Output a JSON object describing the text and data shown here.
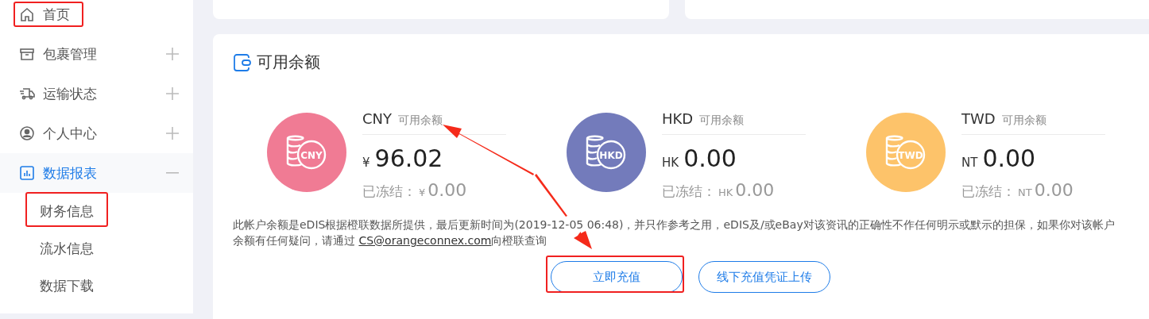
{
  "sidebar": {
    "items": [
      {
        "label": "首页",
        "kind": "link",
        "expanded": false
      },
      {
        "label": "包裹管理",
        "kind": "group",
        "expanded": false
      },
      {
        "label": "运输状态",
        "kind": "group",
        "expanded": false
      },
      {
        "label": "个人中心",
        "kind": "group",
        "expanded": false
      },
      {
        "label": "数据报表",
        "kind": "group",
        "expanded": true,
        "children": [
          {
            "label": "财务信息"
          },
          {
            "label": "流水信息"
          },
          {
            "label": "数据下载"
          }
        ]
      }
    ]
  },
  "balance_card": {
    "title": "可用余额",
    "balances": [
      {
        "currency": "CNY",
        "label": "可用余额",
        "color": "#f07b94",
        "icon_label": "CNY",
        "symbol": "¥",
        "amount": "96.02",
        "frozen_label": "已冻结：",
        "frozen_symbol": "¥",
        "frozen_amount": "0.00"
      },
      {
        "currency": "HKD",
        "label": "可用余额",
        "color": "#737bbb",
        "icon_label": "HKD",
        "symbol": "HK",
        "amount": "0.00",
        "frozen_label": "已冻结：",
        "frozen_symbol": "HK",
        "frozen_amount": "0.00"
      },
      {
        "currency": "TWD",
        "label": "可用余额",
        "color": "#fdc36a",
        "icon_label": "TWD",
        "symbol": "NT",
        "amount": "0.00",
        "frozen_label": "已冻结：",
        "frozen_symbol": "NT",
        "frozen_amount": "0.00"
      }
    ],
    "note_before": "此帐户余额是eDIS根据橙联数据所提供，最后更新时间为(2019-12-05 06:48)，并只作参考之用，eDIS及/或eBay对该资讯的正确性不作任何明示或默示的担保，如果你对该帐户余额有任何疑问，请通过 ",
    "note_link": "CS@orangeconnex.com",
    "note_after": "向橙联查询",
    "buttons": [
      {
        "label": "立即充值"
      },
      {
        "label": "线下充值凭证上传"
      }
    ]
  }
}
